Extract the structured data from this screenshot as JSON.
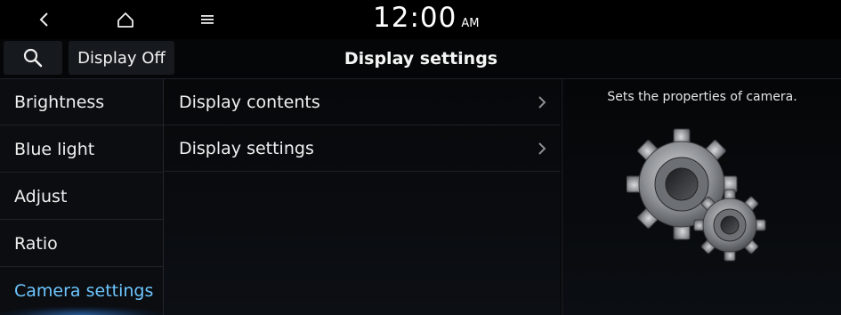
{
  "statusbar": {
    "back_icon": "back-arrow-icon",
    "home_icon": "home-icon",
    "menu_icon": "menu-icon",
    "time": "12:00",
    "ampm": "AM"
  },
  "header": {
    "search_icon": "search-icon",
    "display_off_label": "Display Off",
    "title": "Display settings"
  },
  "sidebar": {
    "items": [
      {
        "label": "Brightness"
      },
      {
        "label": "Blue light"
      },
      {
        "label": "Adjust"
      },
      {
        "label": "Ratio"
      },
      {
        "label": "Camera settings",
        "active": true
      }
    ]
  },
  "main": {
    "items": [
      {
        "label": "Display contents"
      },
      {
        "label": "Display settings"
      }
    ]
  },
  "help": {
    "description": "Sets the properties of camera.",
    "illustration": "gears-icon"
  },
  "colors": {
    "background": "#000000",
    "active": "#6ec6ff",
    "text": "#f0f0f0"
  }
}
